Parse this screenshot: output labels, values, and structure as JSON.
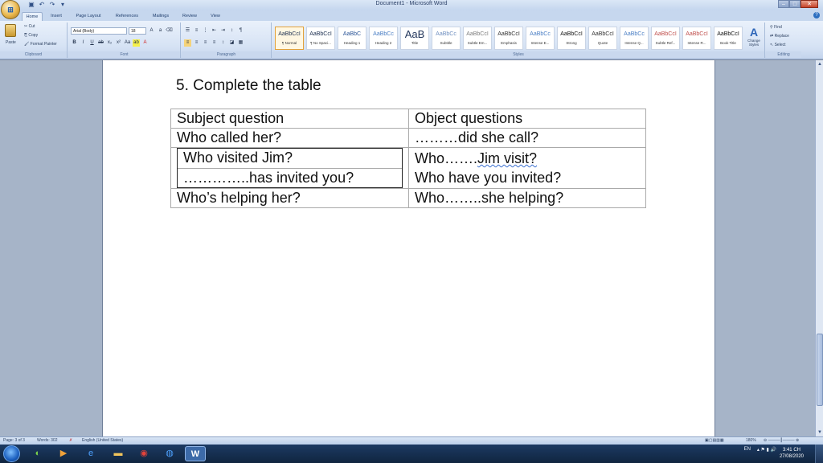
{
  "window": {
    "title": "Document1 - Microsoft Word",
    "controls": {
      "minimize": "–",
      "maximize": "□",
      "close": "✕"
    }
  },
  "tabs": [
    "Home",
    "Insert",
    "Page Layout",
    "References",
    "Mailings",
    "Review",
    "View"
  ],
  "ribbon": {
    "clipboard": {
      "paste": "Paste",
      "cut": "Cut",
      "copy": "Copy",
      "format_painter": "Format Painter",
      "label": "Clipboard"
    },
    "font": {
      "name": "Arial (Body)",
      "size": "18",
      "label": "Font"
    },
    "paragraph": {
      "label": "Paragraph"
    },
    "styles": {
      "label": "Styles",
      "items": [
        {
          "sample": "AaBbCcI",
          "name": "¶ Normal",
          "color": "#1c2f50"
        },
        {
          "sample": "AaBbCcI",
          "name": "¶ No Spaci...",
          "color": "#1c2f50"
        },
        {
          "sample": "AaBbC",
          "name": "Heading 1",
          "color": "#2b5597"
        },
        {
          "sample": "AaBbCc",
          "name": "Heading 2",
          "color": "#4a7ec4"
        },
        {
          "sample": "AaB",
          "name": "Title",
          "color": "#23375c"
        },
        {
          "sample": "AaBbCc",
          "name": "Subtitle",
          "color": "#6f8fc0"
        },
        {
          "sample": "AaBbCcI",
          "name": "Subtle Em...",
          "color": "#7d7d7d"
        },
        {
          "sample": "AaBbCcI",
          "name": "Emphasis",
          "color": "#333333"
        },
        {
          "sample": "AaBbCc",
          "name": "Intense E...",
          "color": "#4a7ec4"
        },
        {
          "sample": "AaBbCcI",
          "name": "Strong",
          "color": "#111111"
        },
        {
          "sample": "AaBbCcI",
          "name": "Quote",
          "color": "#333333"
        },
        {
          "sample": "AaBbCc",
          "name": "Intense Q...",
          "color": "#4a7ec4"
        },
        {
          "sample": "AaBbCcI",
          "name": "Subtle Ref...",
          "color": "#c0504d"
        },
        {
          "sample": "AaBbCcI",
          "name": "Intense R...",
          "color": "#c0504d"
        },
        {
          "sample": "AaBbCcI",
          "name": "Book Title",
          "color": "#111111"
        }
      ],
      "change_styles": "Change Styles"
    },
    "editing": {
      "find": "Find",
      "replace": "Replace",
      "select": "Select",
      "label": "Editing"
    }
  },
  "document": {
    "heading": "5. Complete the table",
    "table": {
      "header": [
        "Subject question",
        "Object questions"
      ],
      "row1": [
        "Who called her?",
        "………did she call?"
      ],
      "nested_left": [
        "Who visited Jim?",
        "…………..has invited you?"
      ],
      "nested_right_a": "Who…….",
      "nested_right_b": "Jim visit?",
      "nested_right_2": "Who have you invited?",
      "row3": [
        "Who’s helping her?",
        "Who……..she helping?"
      ]
    }
  },
  "statusbar": {
    "page": "Page: 3 of 3",
    "words": "Words: 302",
    "language": "English (United States)",
    "zoom": "180%"
  },
  "taskbar": {
    "lang": "EN",
    "time": "3:41 CH",
    "date": "27/08/2020"
  }
}
